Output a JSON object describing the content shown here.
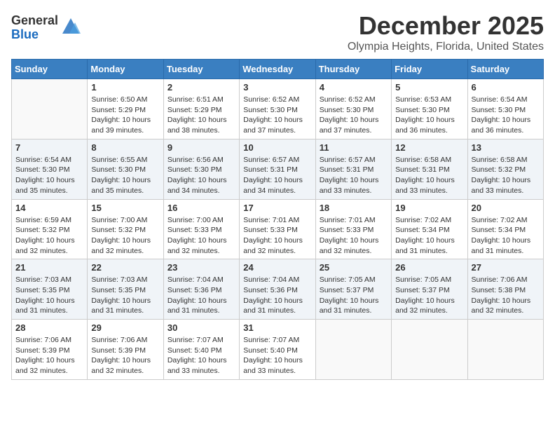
{
  "logo": {
    "general": "General",
    "blue": "Blue"
  },
  "title": "December 2025",
  "location": "Olympia Heights, Florida, United States",
  "weekdays": [
    "Sunday",
    "Monday",
    "Tuesday",
    "Wednesday",
    "Thursday",
    "Friday",
    "Saturday"
  ],
  "weeks": [
    [
      {
        "day": "",
        "sunrise": "",
        "sunset": "",
        "daylight": ""
      },
      {
        "day": "1",
        "sunrise": "Sunrise: 6:50 AM",
        "sunset": "Sunset: 5:29 PM",
        "daylight": "Daylight: 10 hours and 39 minutes."
      },
      {
        "day": "2",
        "sunrise": "Sunrise: 6:51 AM",
        "sunset": "Sunset: 5:29 PM",
        "daylight": "Daylight: 10 hours and 38 minutes."
      },
      {
        "day": "3",
        "sunrise": "Sunrise: 6:52 AM",
        "sunset": "Sunset: 5:30 PM",
        "daylight": "Daylight: 10 hours and 37 minutes."
      },
      {
        "day": "4",
        "sunrise": "Sunrise: 6:52 AM",
        "sunset": "Sunset: 5:30 PM",
        "daylight": "Daylight: 10 hours and 37 minutes."
      },
      {
        "day": "5",
        "sunrise": "Sunrise: 6:53 AM",
        "sunset": "Sunset: 5:30 PM",
        "daylight": "Daylight: 10 hours and 36 minutes."
      },
      {
        "day": "6",
        "sunrise": "Sunrise: 6:54 AM",
        "sunset": "Sunset: 5:30 PM",
        "daylight": "Daylight: 10 hours and 36 minutes."
      }
    ],
    [
      {
        "day": "7",
        "sunrise": "Sunrise: 6:54 AM",
        "sunset": "Sunset: 5:30 PM",
        "daylight": "Daylight: 10 hours and 35 minutes."
      },
      {
        "day": "8",
        "sunrise": "Sunrise: 6:55 AM",
        "sunset": "Sunset: 5:30 PM",
        "daylight": "Daylight: 10 hours and 35 minutes."
      },
      {
        "day": "9",
        "sunrise": "Sunrise: 6:56 AM",
        "sunset": "Sunset: 5:30 PM",
        "daylight": "Daylight: 10 hours and 34 minutes."
      },
      {
        "day": "10",
        "sunrise": "Sunrise: 6:57 AM",
        "sunset": "Sunset: 5:31 PM",
        "daylight": "Daylight: 10 hours and 34 minutes."
      },
      {
        "day": "11",
        "sunrise": "Sunrise: 6:57 AM",
        "sunset": "Sunset: 5:31 PM",
        "daylight": "Daylight: 10 hours and 33 minutes."
      },
      {
        "day": "12",
        "sunrise": "Sunrise: 6:58 AM",
        "sunset": "Sunset: 5:31 PM",
        "daylight": "Daylight: 10 hours and 33 minutes."
      },
      {
        "day": "13",
        "sunrise": "Sunrise: 6:58 AM",
        "sunset": "Sunset: 5:32 PM",
        "daylight": "Daylight: 10 hours and 33 minutes."
      }
    ],
    [
      {
        "day": "14",
        "sunrise": "Sunrise: 6:59 AM",
        "sunset": "Sunset: 5:32 PM",
        "daylight": "Daylight: 10 hours and 32 minutes."
      },
      {
        "day": "15",
        "sunrise": "Sunrise: 7:00 AM",
        "sunset": "Sunset: 5:32 PM",
        "daylight": "Daylight: 10 hours and 32 minutes."
      },
      {
        "day": "16",
        "sunrise": "Sunrise: 7:00 AM",
        "sunset": "Sunset: 5:33 PM",
        "daylight": "Daylight: 10 hours and 32 minutes."
      },
      {
        "day": "17",
        "sunrise": "Sunrise: 7:01 AM",
        "sunset": "Sunset: 5:33 PM",
        "daylight": "Daylight: 10 hours and 32 minutes."
      },
      {
        "day": "18",
        "sunrise": "Sunrise: 7:01 AM",
        "sunset": "Sunset: 5:33 PM",
        "daylight": "Daylight: 10 hours and 32 minutes."
      },
      {
        "day": "19",
        "sunrise": "Sunrise: 7:02 AM",
        "sunset": "Sunset: 5:34 PM",
        "daylight": "Daylight: 10 hours and 31 minutes."
      },
      {
        "day": "20",
        "sunrise": "Sunrise: 7:02 AM",
        "sunset": "Sunset: 5:34 PM",
        "daylight": "Daylight: 10 hours and 31 minutes."
      }
    ],
    [
      {
        "day": "21",
        "sunrise": "Sunrise: 7:03 AM",
        "sunset": "Sunset: 5:35 PM",
        "daylight": "Daylight: 10 hours and 31 minutes."
      },
      {
        "day": "22",
        "sunrise": "Sunrise: 7:03 AM",
        "sunset": "Sunset: 5:35 PM",
        "daylight": "Daylight: 10 hours and 31 minutes."
      },
      {
        "day": "23",
        "sunrise": "Sunrise: 7:04 AM",
        "sunset": "Sunset: 5:36 PM",
        "daylight": "Daylight: 10 hours and 31 minutes."
      },
      {
        "day": "24",
        "sunrise": "Sunrise: 7:04 AM",
        "sunset": "Sunset: 5:36 PM",
        "daylight": "Daylight: 10 hours and 31 minutes."
      },
      {
        "day": "25",
        "sunrise": "Sunrise: 7:05 AM",
        "sunset": "Sunset: 5:37 PM",
        "daylight": "Daylight: 10 hours and 31 minutes."
      },
      {
        "day": "26",
        "sunrise": "Sunrise: 7:05 AM",
        "sunset": "Sunset: 5:37 PM",
        "daylight": "Daylight: 10 hours and 32 minutes."
      },
      {
        "day": "27",
        "sunrise": "Sunrise: 7:06 AM",
        "sunset": "Sunset: 5:38 PM",
        "daylight": "Daylight: 10 hours and 32 minutes."
      }
    ],
    [
      {
        "day": "28",
        "sunrise": "Sunrise: 7:06 AM",
        "sunset": "Sunset: 5:39 PM",
        "daylight": "Daylight: 10 hours and 32 minutes."
      },
      {
        "day": "29",
        "sunrise": "Sunrise: 7:06 AM",
        "sunset": "Sunset: 5:39 PM",
        "daylight": "Daylight: 10 hours and 32 minutes."
      },
      {
        "day": "30",
        "sunrise": "Sunrise: 7:07 AM",
        "sunset": "Sunset: 5:40 PM",
        "daylight": "Daylight: 10 hours and 33 minutes."
      },
      {
        "day": "31",
        "sunrise": "Sunrise: 7:07 AM",
        "sunset": "Sunset: 5:40 PM",
        "daylight": "Daylight: 10 hours and 33 minutes."
      },
      {
        "day": "",
        "sunrise": "",
        "sunset": "",
        "daylight": ""
      },
      {
        "day": "",
        "sunrise": "",
        "sunset": "",
        "daylight": ""
      },
      {
        "day": "",
        "sunrise": "",
        "sunset": "",
        "daylight": ""
      }
    ]
  ]
}
